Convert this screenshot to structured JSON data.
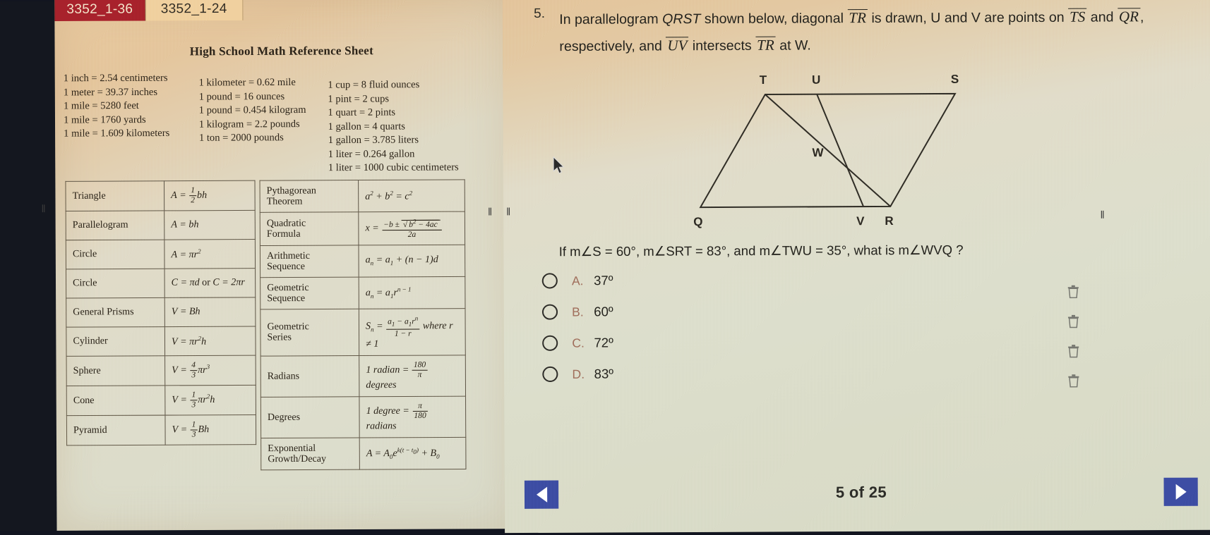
{
  "window": {
    "tabs": [
      {
        "id": "tab-inactive",
        "label": "3352_1-36",
        "state": "inactive"
      },
      {
        "id": "tab-active",
        "label": "3352_1-24",
        "state": "active"
      }
    ]
  },
  "reference_sheet": {
    "title": "High School Math Reference Sheet",
    "conversions": {
      "column1": [
        "1 inch = 2.54 centimeters",
        "1 meter = 39.37 inches",
        "1 mile = 5280 feet",
        "1 mile = 1760 yards",
        "1 mile = 1.609 kilometers"
      ],
      "column2": [
        "1 kilometer = 0.62 mile",
        "1 pound = 16 ounces",
        "1 pound = 0.454 kilogram",
        "1 kilogram = 2.2 pounds",
        "1 ton = 2000 pounds"
      ],
      "column3": [
        "1 cup = 8 fluid ounces",
        "1 pint = 2 cups",
        "1 quart = 2 pints",
        "1 gallon = 4 quarts",
        "1 gallon = 3.785 liters",
        "1 liter = 0.264 gallon",
        "1 liter = 1000 cubic centimeters"
      ]
    },
    "table_area_volume": [
      {
        "label": "Triangle",
        "formula": "A = 1/2 bh"
      },
      {
        "label": "Parallelogram",
        "formula": "A = bh"
      },
      {
        "label": "Circle",
        "formula": "A = πr²"
      },
      {
        "label": "Circle",
        "formula": "C = πd or C = 2πr"
      },
      {
        "label": "General Prisms",
        "formula": "V = Bh"
      },
      {
        "label": "Cylinder",
        "formula": "V = πr²h"
      },
      {
        "label": "Sphere",
        "formula": "V = 4/3 πr³"
      },
      {
        "label": "Cone",
        "formula": "V = 1/3 πr²h"
      },
      {
        "label": "Pyramid",
        "formula": "V = 1/3 Bh"
      }
    ],
    "table_formulas": [
      {
        "label": "Pythagorean Theorem",
        "formula": "a² + b² = c²"
      },
      {
        "label": "Quadratic Formula",
        "formula": "x = (−b ± √(b² − 4ac)) / 2a"
      },
      {
        "label": "Arithmetic Sequence",
        "formula": "aₙ = a₁ + (n − 1)d"
      },
      {
        "label": "Geometric Sequence",
        "formula": "aₙ = a₁rⁿ⁻¹"
      },
      {
        "label": "Geometric Series",
        "formula": "Sₙ = (a₁ − a₁rⁿ)/(1 − r) where r ≠ 1"
      },
      {
        "label": "Radians",
        "formula": "1 radian = 180/π degrees"
      },
      {
        "label": "Degrees",
        "formula": "1 degree = π/180 radians"
      },
      {
        "label": "Exponential Growth/Decay",
        "formula": "A = A₀e^{k(t − t₀)} + B₀"
      }
    ]
  },
  "question": {
    "number": "5.",
    "stem_part1": "In parallelogram",
    "stem_qrst": "QRST",
    "stem_part2": "shown below, diagonal",
    "seg_tr_1": "TR",
    "stem_part3": "is drawn, U and V are points on",
    "seg_ts": "TS",
    "stem_and": "and",
    "seg_qr": "QR",
    "stem_part4": ", respectively, and",
    "seg_uv": "UV",
    "stem_part5": "intersects",
    "seg_tr_2": "TR",
    "stem_part6": "at W.",
    "ask": "If m∠S = 60°, m∠SRT = 83°, and m∠TWU = 35°, what is m∠WVQ ?",
    "options": [
      {
        "letter": "A.",
        "text": "37º",
        "selected": false
      },
      {
        "letter": "B.",
        "text": "60º",
        "selected": false
      },
      {
        "letter": "C.",
        "text": "72º",
        "selected": false
      },
      {
        "letter": "D.",
        "text": "83º",
        "selected": false
      }
    ],
    "figure": {
      "vertex_labels": [
        "T",
        "U",
        "S",
        "W",
        "Q",
        "V",
        "R"
      ]
    }
  },
  "navigation": {
    "prev_label": "previous-question",
    "next_label": "next-question",
    "page_counter": "5 of 25"
  },
  "side_tools": {
    "items": [
      "delete-icon",
      "delete-icon",
      "delete-icon",
      "delete-icon"
    ]
  },
  "colors": {
    "tab_active_bg": "#f0cf9c",
    "tab_inactive_bg": "#a5212a",
    "nav_button_bg": "#3b4aa0",
    "option_letter": "#9d6a58",
    "paper_bg": "#dcdcc9"
  }
}
